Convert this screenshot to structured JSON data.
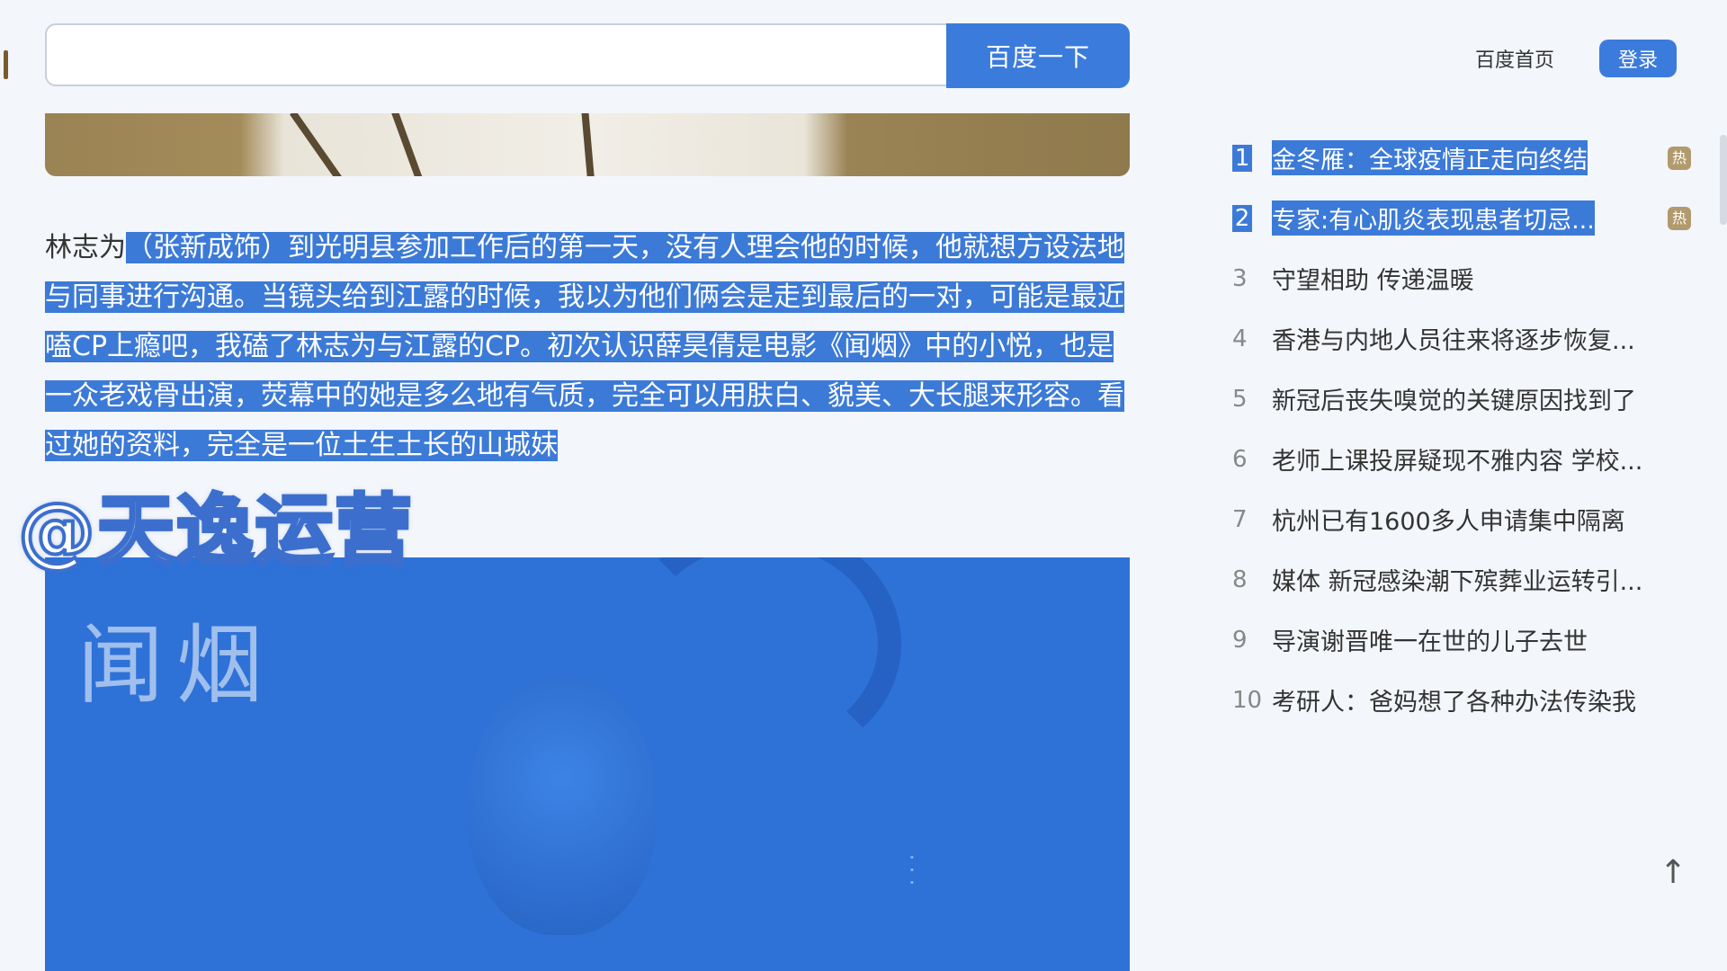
{
  "search": {
    "placeholder": "",
    "button_label": "百度一下"
  },
  "header": {
    "home_link": "百度首页",
    "login_label": "登录"
  },
  "article": {
    "unselected_prefix": "林志为",
    "selected_text": "（张新成饰）到光明县参加工作后的第一天，没有人理会他的时候，他就想方设法地与同事进行沟通。当镜头给到江露的时候，我以为他们俩会是走到最后的一对，可能是最近嗑CP上瘾吧，我磕了林志为与江露的CP。初次认识薛昊倩是电影《闻烟》中的小悦，也是一众老戏骨出演，荧幕中的她是多么地有气质，完全可以用肤白、貌美、大长腿来形容。看过她的资料，完全是一位土生土长的山城妹"
  },
  "watermark": "@天逸运营",
  "poster": {
    "title": "闻烟"
  },
  "hotlist": {
    "items": [
      {
        "rank": "1",
        "title": "金冬雁：全球疫情正走向终结",
        "badge": "热",
        "selected": true
      },
      {
        "rank": "2",
        "title": "专家:有心肌炎表现患者切忌...",
        "badge": "热",
        "selected": true
      },
      {
        "rank": "3",
        "title": "守望相助 传递温暖"
      },
      {
        "rank": "4",
        "title": "香港与内地人员往来将逐步恢复..."
      },
      {
        "rank": "5",
        "title": "新冠后丧失嗅觉的关键原因找到了"
      },
      {
        "rank": "6",
        "title": "老师上课投屏疑现不雅内容 学校..."
      },
      {
        "rank": "7",
        "title": "杭州已有1600多人申请集中隔离"
      },
      {
        "rank": "8",
        "title": "媒体 新冠感染潮下殡葬业运转引..."
      },
      {
        "rank": "9",
        "title": "导演谢晋唯一在世的儿子去世"
      },
      {
        "rank": "10",
        "title": "考研人：爸妈想了各种办法传染我"
      }
    ]
  },
  "back_to_top": "↑"
}
